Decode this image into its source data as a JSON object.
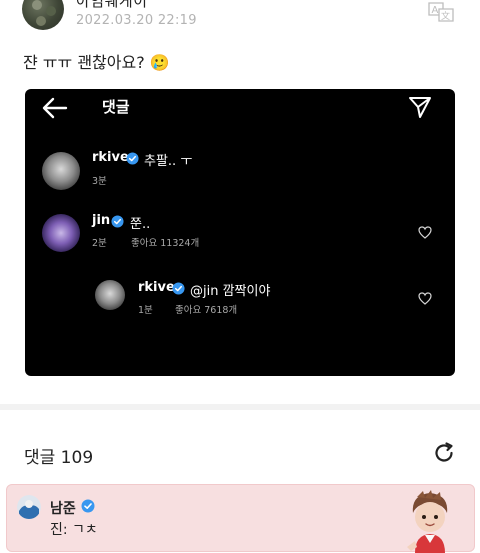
{
  "post": {
    "author": "아임웨게이",
    "author_more": "-",
    "timestamp": "2022.03.20 22:19",
    "body": "쟌 ㅠㅠ 괜찮아요? 🥲"
  },
  "embed": {
    "title": "댓글",
    "comments": [
      {
        "username": "rkive",
        "text": "추팔.. ㅜ",
        "time": "3분",
        "likes": ""
      },
      {
        "username": "jin",
        "text": "쭌..",
        "time": "2분",
        "likes": "좋아요 11324개"
      },
      {
        "username": "rkive",
        "text": "@jin 깜짝이야",
        "time": "1분",
        "likes": "좋아요 7618개"
      }
    ]
  },
  "comments_section": {
    "title": "댓글 109"
  },
  "best_comment": {
    "author": "남준",
    "text": "진: ㄱㅊ"
  },
  "colors": {
    "verified": "#3897f0",
    "best_comment_bg": "#f7dfe0",
    "embed_bg": "#000000"
  }
}
